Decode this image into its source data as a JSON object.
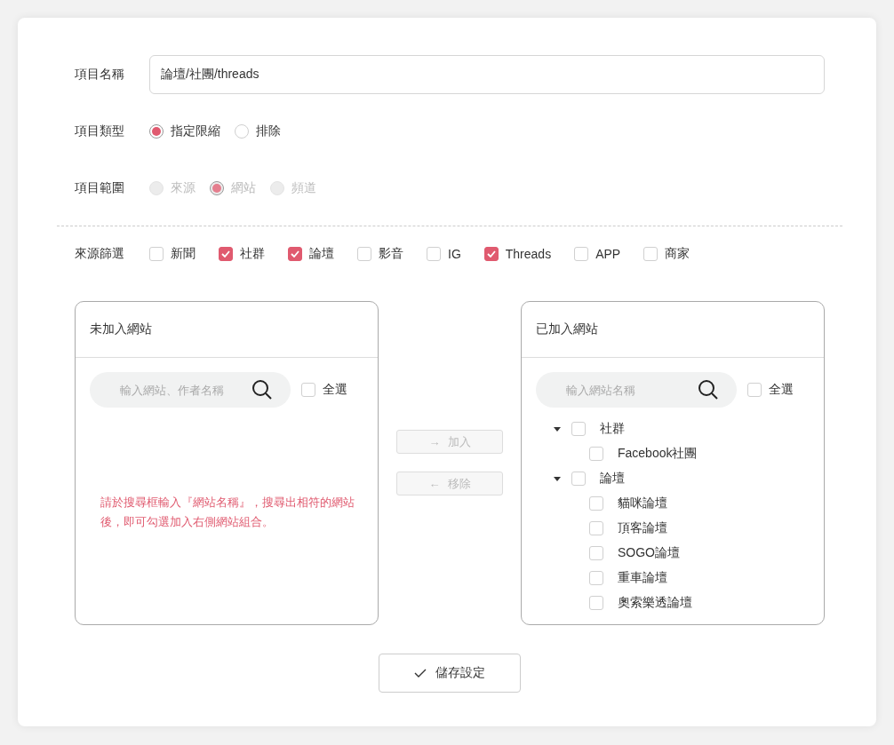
{
  "form": {
    "name": {
      "label": "項目名稱",
      "value": "論壇/社團/threads"
    },
    "type": {
      "label": "項目類型",
      "options": [
        {
          "label": "指定限縮",
          "selected": true,
          "disabled": false
        },
        {
          "label": "排除",
          "selected": false,
          "disabled": false
        }
      ]
    },
    "scope": {
      "label": "項目範圍",
      "options": [
        {
          "label": "來源",
          "selected": false,
          "disabled": true
        },
        {
          "label": "網站",
          "selected": true,
          "disabled": true
        },
        {
          "label": "頻道",
          "selected": false,
          "disabled": true
        }
      ]
    },
    "source_filter": {
      "label": "來源篩選",
      "options": [
        {
          "label": "新聞",
          "checked": false
        },
        {
          "label": "社群",
          "checked": true
        },
        {
          "label": "論壇",
          "checked": true
        },
        {
          "label": "影音",
          "checked": false
        },
        {
          "label": "IG",
          "checked": false
        },
        {
          "label": "Threads",
          "checked": true
        },
        {
          "label": "APP",
          "checked": false
        },
        {
          "label": "商家",
          "checked": false
        }
      ]
    }
  },
  "left_panel": {
    "title": "未加入網站",
    "search": {
      "placeholder": "輸入網站、作者名稱"
    },
    "select_all": {
      "label": "全選",
      "checked": false
    },
    "hint": "請於搜尋框輸入『網站名稱』，搜尋出相符的網站後，即可勾選加入右側網站組合。"
  },
  "transfer_buttons": [
    {
      "arrow": "→",
      "label": "加入",
      "disabled": true
    },
    {
      "arrow": "←",
      "label": "移除",
      "disabled": true
    }
  ],
  "right_panel": {
    "title": "已加入網站",
    "search": {
      "placeholder": "輸入網站名稱"
    },
    "select_all": {
      "label": "全選",
      "checked": false
    },
    "tree": [
      {
        "label": "社群",
        "checked": false,
        "expanded": true,
        "children": [
          {
            "label": "Facebook社團",
            "checked": false
          }
        ]
      },
      {
        "label": "論壇",
        "checked": false,
        "expanded": true,
        "children": [
          {
            "label": "貓咪論壇",
            "checked": false
          },
          {
            "label": "頂客論壇",
            "checked": false
          },
          {
            "label": "SOGO論壇",
            "checked": false
          },
          {
            "label": "重車論壇",
            "checked": false
          },
          {
            "label": "奧索樂透論壇",
            "checked": false
          }
        ]
      }
    ]
  },
  "save_button": {
    "label": "儲存設定"
  }
}
